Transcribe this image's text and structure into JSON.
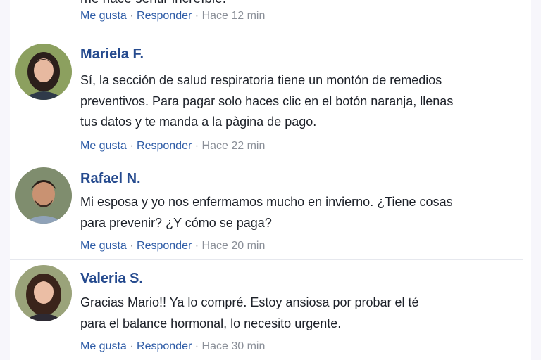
{
  "top": {
    "clipped_text": "me hace sentir increíble.",
    "like_label": "Me gusta",
    "reply_label": "Responder",
    "time": "Hace 12 min"
  },
  "comments": [
    {
      "name": "Mariela F.",
      "lines": [
        "Sí, la sección de salud respiratoria tiene un montón de remedios",
        "preventivos. Para pagar solo haces clic en el botón naranja, llenas",
        "tus datos y te manda a la pàgina de pago."
      ],
      "like_label": "Me gusta",
      "reply_label": "Responder",
      "time": "Hace 22 min"
    },
    {
      "name": "Rafael N.",
      "lines": [
        "Mi esposa y yo nos enfermamos mucho en invierno. ¿Tiene cosas",
        "para prevenir? ¿Y cómo se paga?"
      ],
      "like_label": "Me gusta",
      "reply_label": "Responder",
      "time": "Hace 20 min"
    },
    {
      "name": "Valeria S.",
      "lines": [
        "Gracias Mario!! Ya lo compré. Estoy ansiosa por probar el té",
        "para el balance hormonal, lo necesito urgente."
      ],
      "like_label": "Me gusta",
      "reply_label": "Responder",
      "time": "Hace 30 min"
    }
  ],
  "colors": {
    "name": "#254a8e",
    "link": "#2d5ba6",
    "meta": "#8a8f98",
    "text": "#1d2129"
  }
}
